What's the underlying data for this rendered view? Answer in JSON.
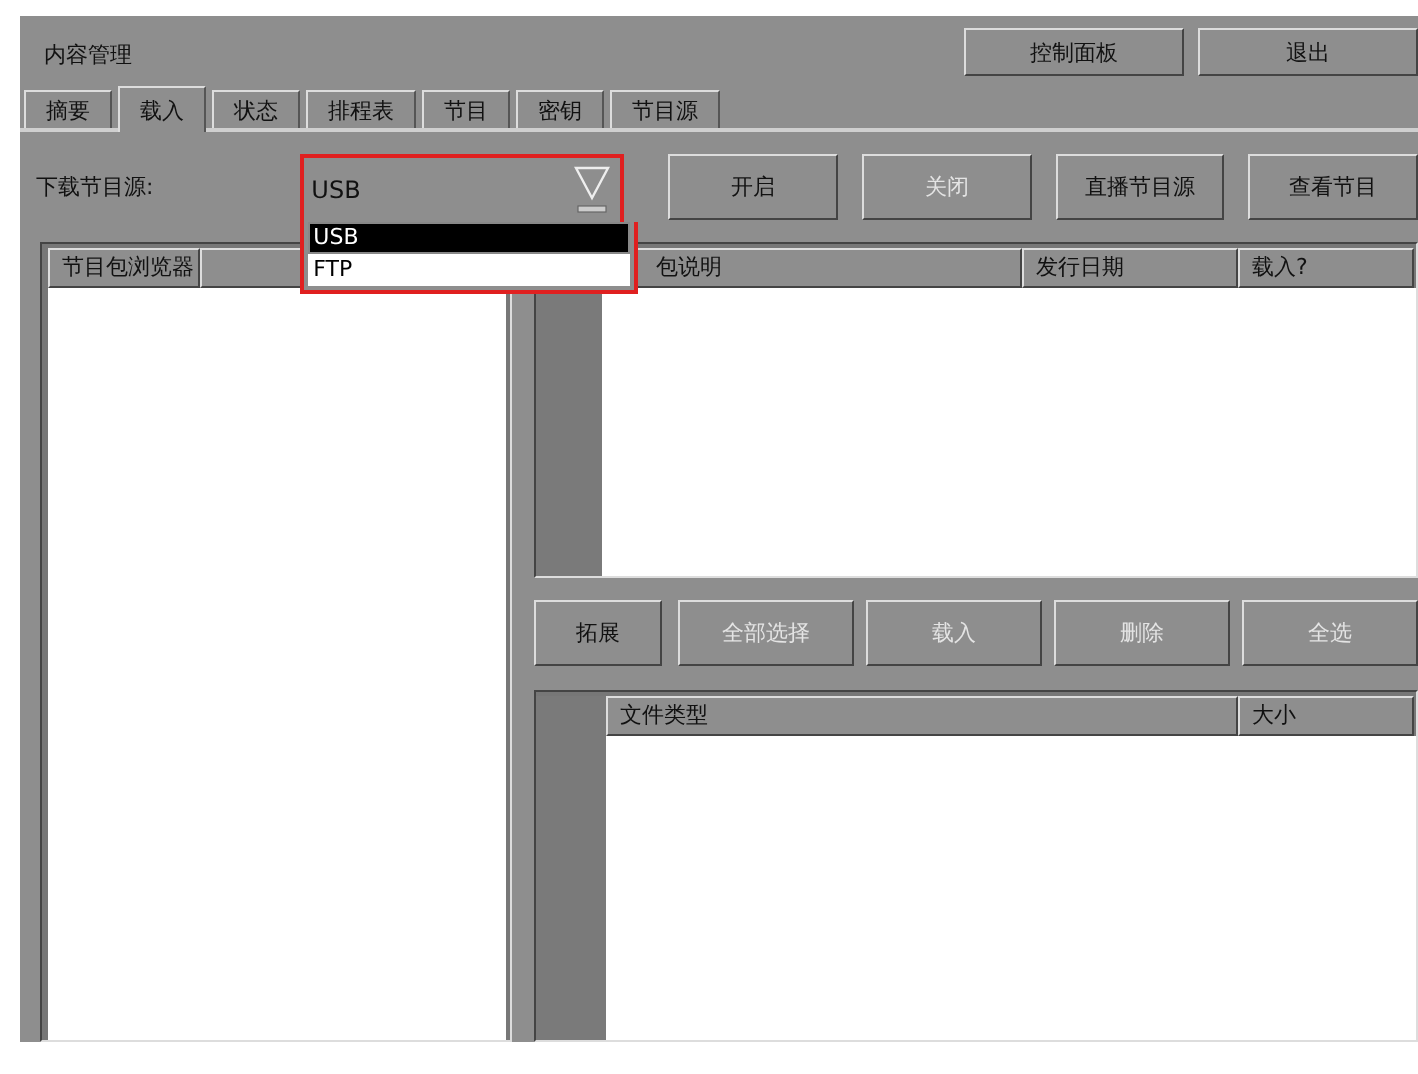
{
  "window": {
    "title": "内容管理"
  },
  "header_buttons": [
    {
      "label": "控制面板",
      "disabled": false
    },
    {
      "label": "退出",
      "disabled": false
    }
  ],
  "tabs": [
    {
      "label": "摘要",
      "selected": false
    },
    {
      "label": "载入",
      "selected": true
    },
    {
      "label": "状态",
      "selected": false
    },
    {
      "label": "排程表",
      "selected": false
    },
    {
      "label": "节目",
      "selected": false
    },
    {
      "label": "密钥",
      "selected": false
    },
    {
      "label": "节目源",
      "selected": false
    }
  ],
  "source": {
    "label": "下载节目源:",
    "value": "USB",
    "options": [
      {
        "label": "USB",
        "selected": true
      },
      {
        "label": "FTP",
        "selected": false
      }
    ]
  },
  "toolbar_buttons": [
    {
      "label": "开启",
      "disabled": false
    },
    {
      "label": "关闭",
      "disabled": true
    },
    {
      "label": "直播节目源",
      "disabled": false
    },
    {
      "label": "查看节目",
      "disabled": false
    }
  ],
  "browser": {
    "columns": [
      "节目包浏览器"
    ]
  },
  "package_table": {
    "columns": [
      "包说明",
      "发行日期",
      "载入?"
    ]
  },
  "action_buttons": [
    {
      "label": "拓展",
      "disabled": false
    },
    {
      "label": "全部选择",
      "disabled": true
    },
    {
      "label": "载入",
      "disabled": true
    },
    {
      "label": "删除",
      "disabled": true
    },
    {
      "label": "全选",
      "disabled": true
    }
  ],
  "file_table": {
    "columns": [
      "文件类型",
      "大小"
    ]
  }
}
